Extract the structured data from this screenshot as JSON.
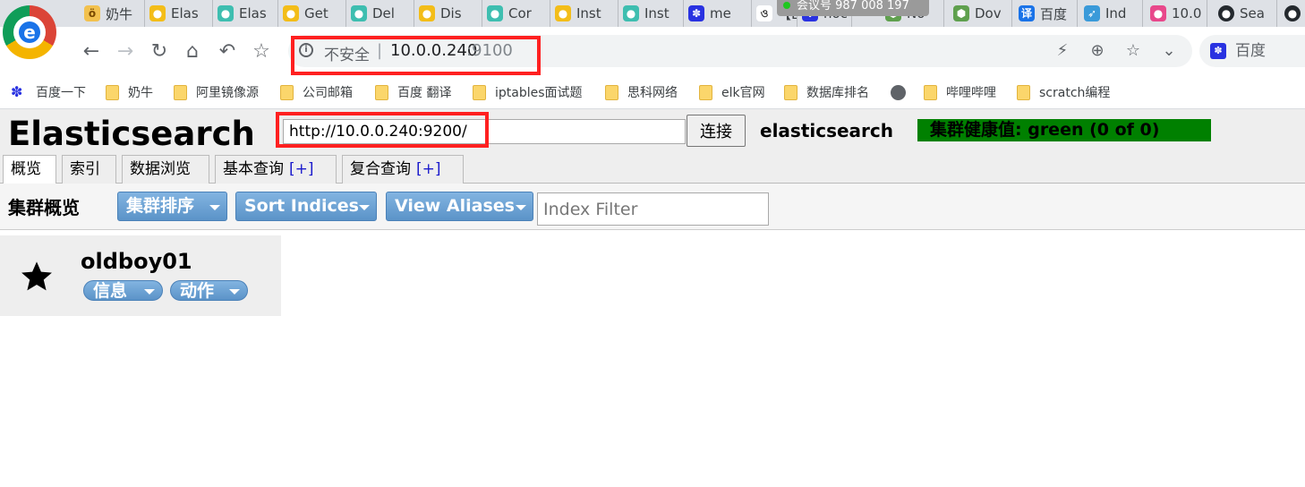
{
  "browser": {
    "tabs": [
      {
        "label": "奶牛",
        "icon": "cow-icon"
      },
      {
        "label": "Elas",
        "icon": "elastic-icon"
      },
      {
        "label": "Elas",
        "icon": "elastic-icon"
      },
      {
        "label": "Get",
        "icon": "elastic-icon"
      },
      {
        "label": "Del",
        "icon": "elastic-icon"
      },
      {
        "label": "Dis",
        "icon": "elastic-icon"
      },
      {
        "label": "Cor",
        "icon": "elastic-icon"
      },
      {
        "label": "Inst",
        "icon": "elastic-icon"
      },
      {
        "label": "Inst",
        "icon": "elastic-icon"
      },
      {
        "label": "me",
        "icon": "baidu-paw-icon"
      },
      {
        "label": "【E",
        "icon": "generic-icon"
      },
      {
        "label": "noc",
        "icon": "paw-icon"
      },
      {
        "label": "No",
        "icon": "nodejs-icon"
      },
      {
        "label": "Dov",
        "icon": "nodejs-icon"
      },
      {
        "label": "百度",
        "icon": "translate-icon"
      },
      {
        "label": "Ind",
        "icon": "bird-icon"
      },
      {
        "label": "10.0",
        "icon": "elastic-icon"
      },
      {
        "label": "Sea",
        "icon": "github-icon"
      }
    ],
    "tooltip": "会议号 987 008 197",
    "address": {
      "insecure_label": "不安全",
      "separator": "|",
      "host": "10.0.0.240",
      "port": ":9100"
    },
    "search_engine_label": "百度",
    "bookmarks": [
      {
        "label": "百度一下",
        "icon": "baidu-paw-icon"
      },
      {
        "label": "奶牛",
        "icon": "folder-icon"
      },
      {
        "label": "阿里镜像源",
        "icon": "folder-icon"
      },
      {
        "label": "公司邮箱",
        "icon": "folder-icon"
      },
      {
        "label": "百度 翻译",
        "icon": "folder-icon"
      },
      {
        "label": "iptables面试题",
        "icon": "folder-icon"
      },
      {
        "label": "思科网络",
        "icon": "folder-icon"
      },
      {
        "label": "elk官网",
        "icon": "folder-icon"
      },
      {
        "label": "数据库排名",
        "icon": "folder-icon"
      },
      {
        "label": "",
        "icon": "globe-icon"
      },
      {
        "label": "哔哩哔哩",
        "icon": "folder-icon"
      },
      {
        "label": "scratch编程",
        "icon": "folder-icon"
      }
    ]
  },
  "app": {
    "title": "Elasticsearch",
    "connect_url": "http://10.0.0.240:9200/",
    "connect_label": "连接",
    "cluster_name": "elasticsearch",
    "cluster_health": "集群健康值: green (0 of 0)",
    "cluster_health_color": "#008000",
    "tabs": [
      {
        "label": "概览",
        "plus": ""
      },
      {
        "label": "索引",
        "plus": ""
      },
      {
        "label": "数据浏览",
        "plus": ""
      },
      {
        "label": "基本查询",
        "plus": "[+]"
      },
      {
        "label": "复合查询",
        "plus": "[+]"
      }
    ],
    "overview": {
      "title": "集群概览",
      "sort_cluster_label": "集群排序",
      "sort_indices_label": "Sort Indices",
      "view_aliases_label": "View Aliases",
      "index_filter_placeholder": "Index Filter"
    },
    "node": {
      "name": "oldboy01",
      "info_label": "信息",
      "action_label": "动作",
      "icon": "star-icon"
    }
  }
}
